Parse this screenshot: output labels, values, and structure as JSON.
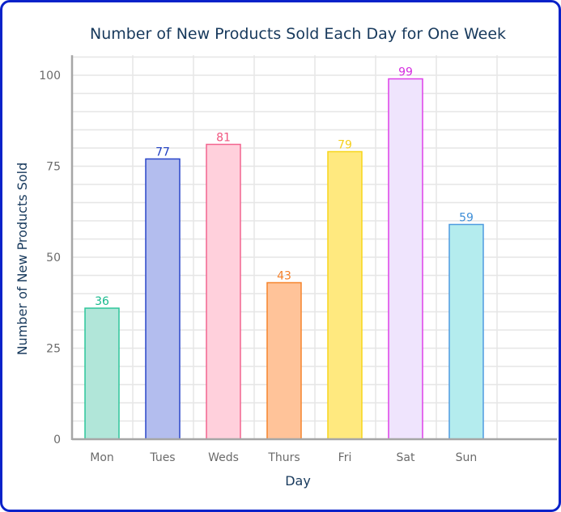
{
  "chart_data": {
    "type": "bar",
    "title": "Number of New Products Sold Each Day for One Week",
    "xlabel": "Day",
    "ylabel": "Number of New Products Sold",
    "categories": [
      "Mon",
      "Tues",
      "Weds",
      "Thurs",
      "Fri",
      "Sat",
      "Sun"
    ],
    "values": [
      36,
      77,
      81,
      43,
      79,
      99,
      59
    ],
    "ylim": [
      0,
      100
    ],
    "yticks": [
      0,
      25,
      50,
      75,
      100
    ],
    "grid": true,
    "legend": "none",
    "data_labels": true,
    "bar_colors": [
      {
        "fill": "#b1e6d9",
        "stroke": "#2ec59a"
      },
      {
        "fill": "#b3bdee",
        "stroke": "#2a46c9"
      },
      {
        "fill": "#ffd0dc",
        "stroke": "#f2648f"
      },
      {
        "fill": "#ffc399",
        "stroke": "#f5842c"
      },
      {
        "fill": "#ffe97f",
        "stroke": "#f7d51a"
      },
      {
        "fill": "#efe4fd",
        "stroke": "#de3fe8"
      },
      {
        "fill": "#b4ecee",
        "stroke": "#4f9be0"
      }
    ],
    "label_colors": [
      "#16b98c",
      "#1f3fc2",
      "#f0557f",
      "#f5802a",
      "#f5cf1c",
      "#d52ee0",
      "#3f8fd8"
    ]
  },
  "colors": {
    "frame": "#0a22c9",
    "title": "#17395c",
    "gridline": "#e6e6e6",
    "axis": "#a6a6a6",
    "tick_text": "#6b6b6b"
  }
}
